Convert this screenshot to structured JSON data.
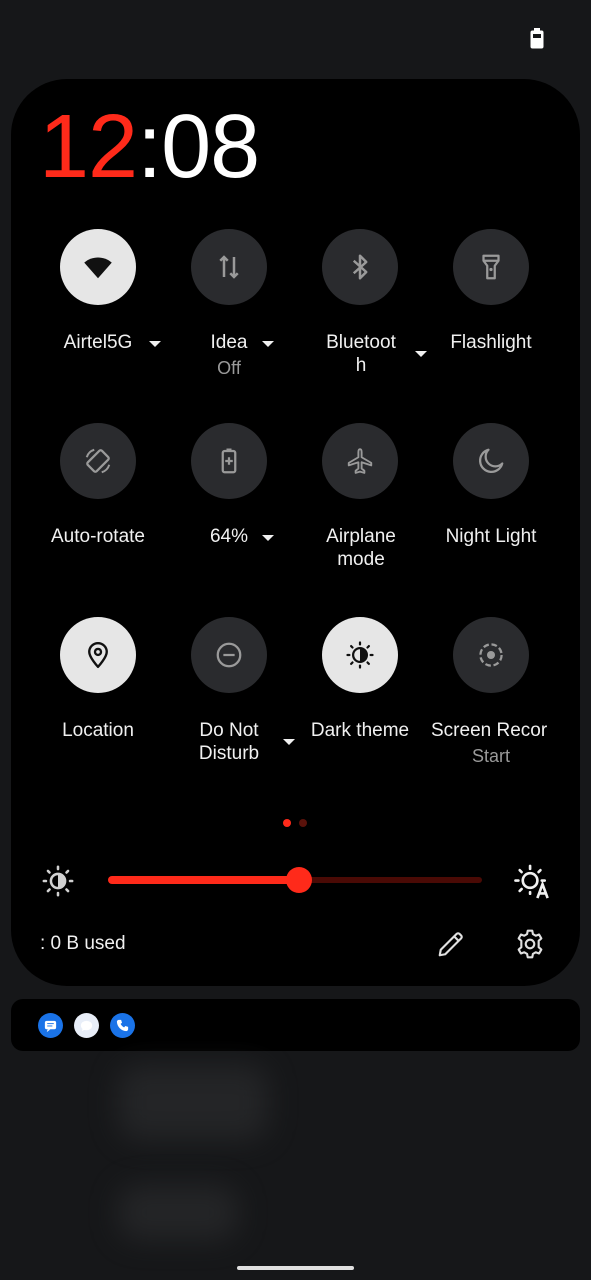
{
  "clock": {
    "hour": "12",
    "rest": ":08"
  },
  "tiles": [
    {
      "label": "Airtel5G",
      "sub": "",
      "icon": "wifi-icon",
      "active": true,
      "dropdown": true
    },
    {
      "label": "Idea",
      "sub": "Off",
      "icon": "mobile-data-icon",
      "active": false,
      "dropdown": true
    },
    {
      "label": "Bluetooth",
      "sub": "",
      "icon": "bluetooth-icon",
      "active": false,
      "dropdown": true
    },
    {
      "label": "Flashlight",
      "sub": "",
      "icon": "flashlight-icon",
      "active": false,
      "dropdown": false
    },
    {
      "label": "Auto-rotate",
      "sub": "",
      "icon": "auto-rotate-icon",
      "active": false,
      "dropdown": false
    },
    {
      "label": "64%",
      "sub": "",
      "icon": "battery-saver-icon",
      "active": false,
      "dropdown": true
    },
    {
      "label": "Airplane mode",
      "sub": "",
      "icon": "airplane-icon",
      "active": false,
      "dropdown": false
    },
    {
      "label": "Night Light",
      "sub": "",
      "icon": "night-light-icon",
      "active": false,
      "dropdown": false
    },
    {
      "label": "Location",
      "sub": "",
      "icon": "location-icon",
      "active": true,
      "dropdown": false
    },
    {
      "label": "Do Not Disturb",
      "sub": "",
      "icon": "do-not-disturb-icon",
      "active": false,
      "dropdown": true
    },
    {
      "label": "Dark theme",
      "sub": "",
      "icon": "dark-theme-icon",
      "active": true,
      "dropdown": false
    },
    {
      "label": "Screen Recor",
      "sub": "Start",
      "icon": "screen-record-icon",
      "active": false,
      "dropdown": false
    }
  ],
  "pages": {
    "count": 2,
    "current": 1
  },
  "brightness": {
    "level": 0.51
  },
  "footer": {
    "data_usage": ": 0 B used"
  },
  "notification_apps": [
    "messages-icon",
    "chat-icon",
    "phone-icon"
  ],
  "colors": {
    "accent": "#ff2a1a",
    "panel": "#000000",
    "tile_inactive": "#2a2b2e",
    "tile_active": "#e6e6e6",
    "background": "#161719"
  }
}
